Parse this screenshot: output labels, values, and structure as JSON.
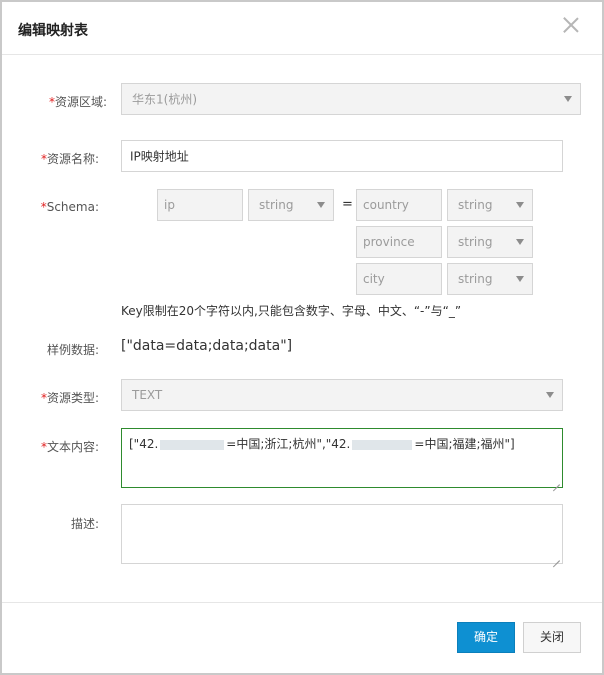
{
  "dialog": {
    "title": "编辑映射表",
    "close_icon": "close-icon"
  },
  "form": {
    "region": {
      "required_mark": "*",
      "label": "资源区域:",
      "value": "华东1(杭州)"
    },
    "name": {
      "required_mark": "*",
      "label": "资源名称:",
      "value": "IP映射地址"
    },
    "schema": {
      "required_mark": "*",
      "label": "Schema:",
      "key": {
        "name": "ip",
        "type": "string"
      },
      "equals": "=",
      "values": [
        {
          "name": "country",
          "type": "string"
        },
        {
          "name": "province",
          "type": "string"
        },
        {
          "name": "city",
          "type": "string"
        }
      ],
      "hint": "Key限制在20个字符以内,只能包含数字、字母、中文、“-”与“_”"
    },
    "sample": {
      "label": "样例数据:",
      "value": "[\"data=data;data;data\"]"
    },
    "type": {
      "required_mark": "*",
      "label": "资源类型:",
      "value": "TEXT"
    },
    "content": {
      "required_mark": "*",
      "label": "文本内容:",
      "part1": "[\"42.",
      "part2": "=中国;浙江;杭州\",\"42.",
      "part3": "=中国;福建;福州\"]"
    },
    "description": {
      "label": "描述:",
      "value": ""
    }
  },
  "footer": {
    "confirm_label": "确定",
    "close_label": "关闭"
  },
  "colors": {
    "primary": "#0e90d2",
    "required": "#e02020",
    "focus_border": "#2e8b2e"
  }
}
